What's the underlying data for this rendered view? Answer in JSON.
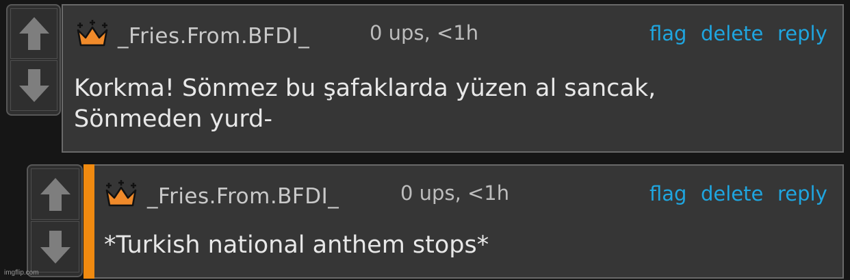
{
  "colors": {
    "background": "#161616",
    "panel": "#363636",
    "link": "#1fa6e0",
    "reply_accent": "#f08a10",
    "crown": "#f08a2a"
  },
  "comments": [
    {
      "username": "_Fries.From.BFDI_",
      "meta": "0 ups, <1h",
      "actions": {
        "flag": "flag",
        "delete": "delete",
        "reply": "reply"
      },
      "text_lines": [
        "Korkma! Sönmez bu şafaklarda yüzen al sancak,",
        "Sönmeden yurd-"
      ],
      "icons": {
        "upvote": "arrow-up-icon",
        "downvote": "arrow-down-icon",
        "badge": "crown-icon"
      }
    },
    {
      "username": "_Fries.From.BFDI_",
      "meta": "0 ups, <1h",
      "actions": {
        "flag": "flag",
        "delete": "delete",
        "reply": "reply"
      },
      "text_lines": [
        "*Turkish national anthem stops*"
      ],
      "icons": {
        "upvote": "arrow-up-icon",
        "downvote": "arrow-down-icon",
        "badge": "crown-icon"
      }
    }
  ],
  "watermark": "imgflip.com"
}
